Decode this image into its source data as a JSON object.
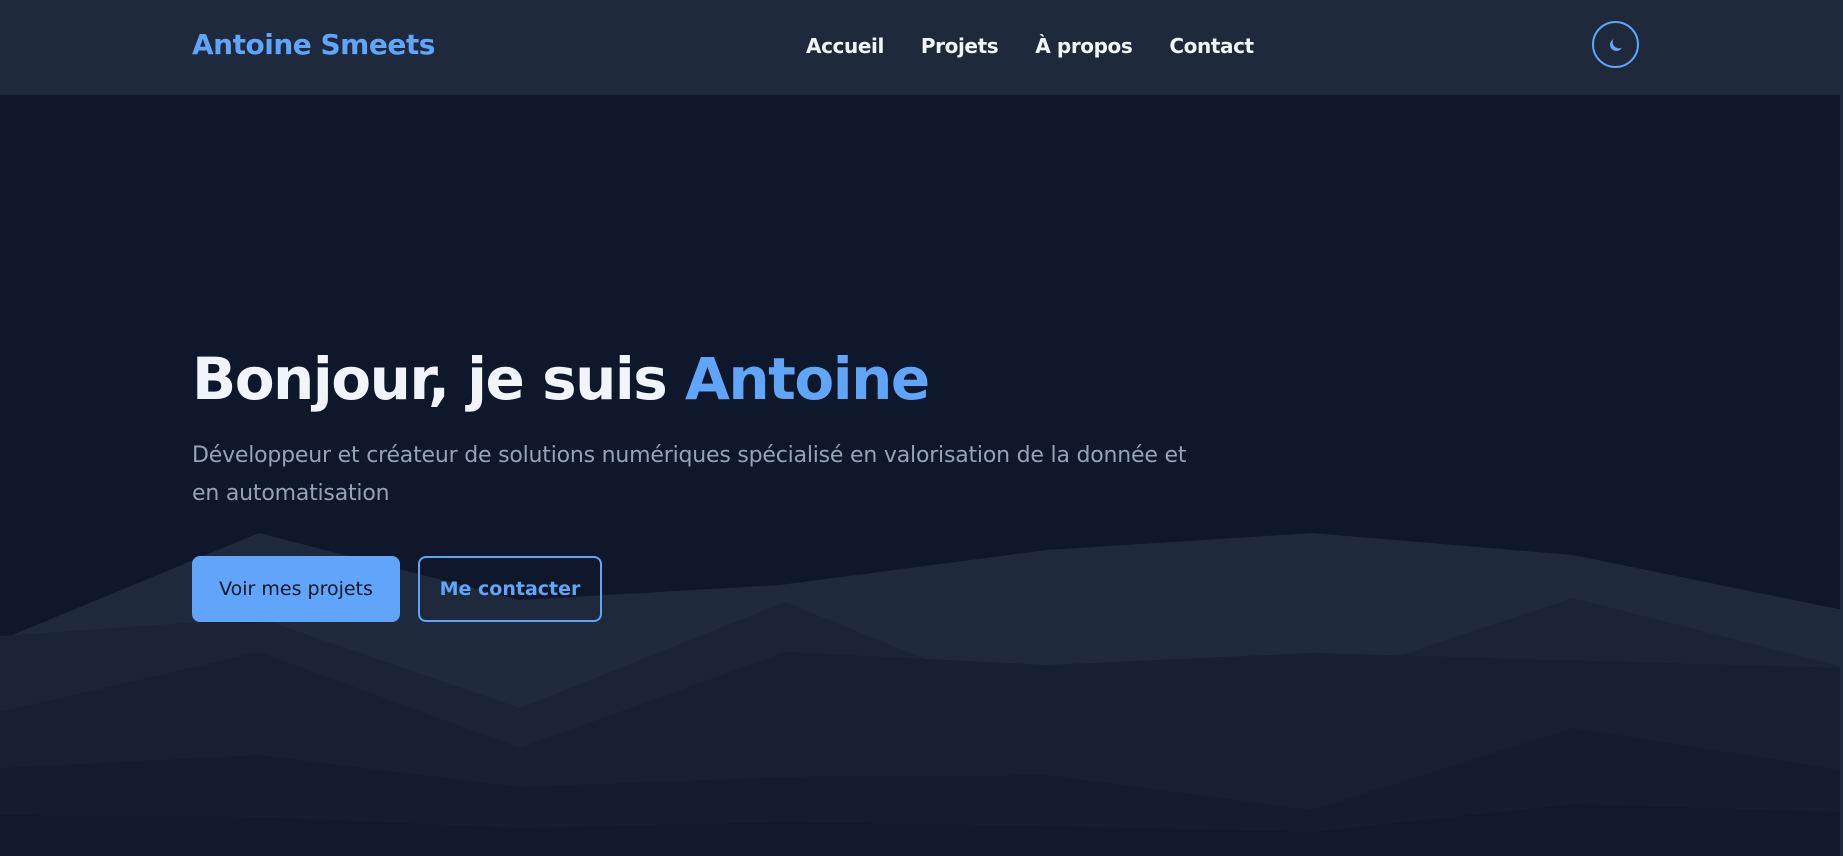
{
  "header": {
    "brand": "Antoine Smeets",
    "nav": [
      "Accueil",
      "Projets",
      "À propos",
      "Contact"
    ],
    "theme_toggle_icon": "moon-icon"
  },
  "hero": {
    "title_prefix": "Bonjour, je suis ",
    "title_name": "Antoine",
    "subtitle": "Développeur et créateur de solutions numériques spécialisé en valorisation de la donnée et en automatisation",
    "primary_button": "Voir mes projets",
    "secondary_button": "Me contacter"
  },
  "colors": {
    "background": "#0f172a",
    "header": "#1e293b",
    "accent": "#60a5fa",
    "text": "#f1f5f9",
    "muted": "#94a3b8"
  }
}
